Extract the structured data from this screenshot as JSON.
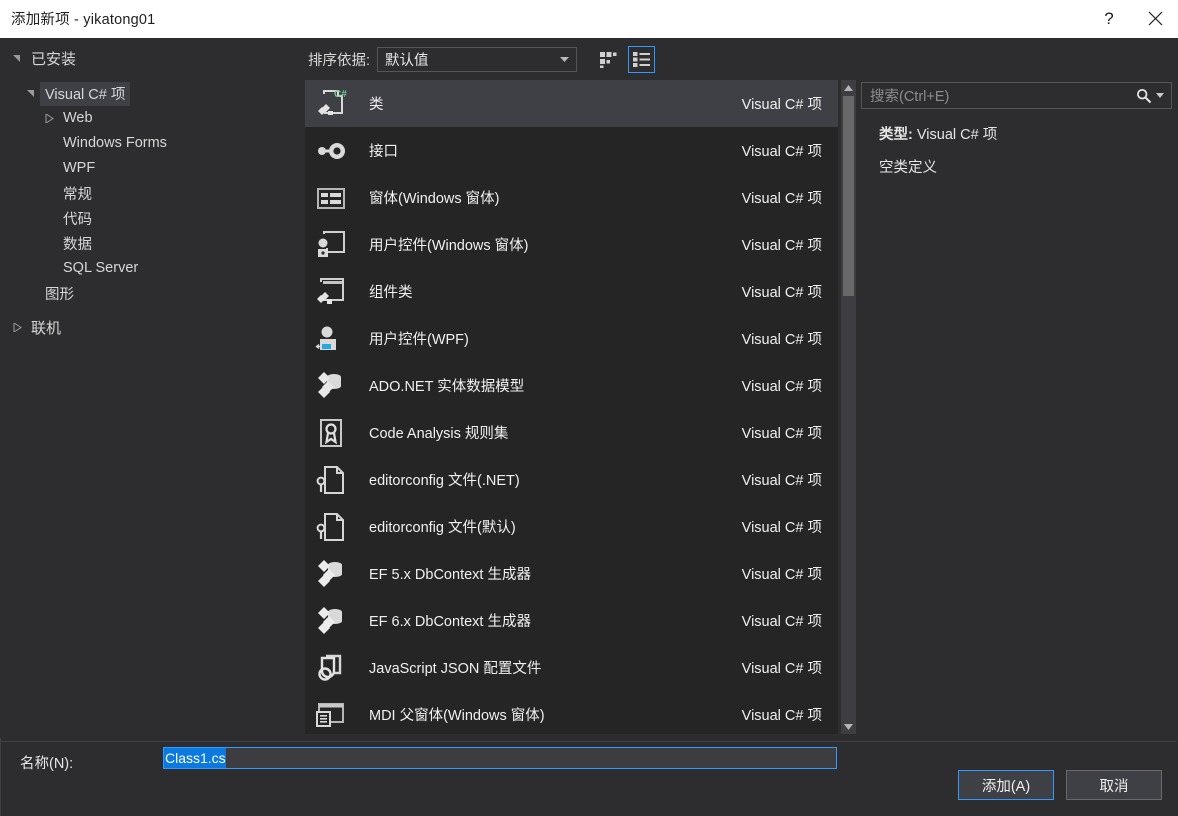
{
  "window": {
    "title": "添加新项 - yikatong01",
    "help_icon": "question-mark-icon",
    "close_icon": "close-icon"
  },
  "sidebar": {
    "installed": {
      "label": "已安装",
      "expanded": true
    },
    "items": [
      {
        "label": "Visual C# 项",
        "level": 1,
        "state": "expanded",
        "selected": true
      },
      {
        "label": "Web",
        "level": 2,
        "state": "collapsed",
        "selected": false
      },
      {
        "label": "Windows Forms",
        "level": 2,
        "state": "leaf",
        "selected": false
      },
      {
        "label": "WPF",
        "level": 2,
        "state": "leaf",
        "selected": false
      },
      {
        "label": "常规",
        "level": 2,
        "state": "leaf",
        "selected": false
      },
      {
        "label": "代码",
        "level": 2,
        "state": "leaf",
        "selected": false
      },
      {
        "label": "数据",
        "level": 2,
        "state": "leaf",
        "selected": false
      },
      {
        "label": "SQL Server",
        "level": 2,
        "state": "leaf",
        "selected": false
      },
      {
        "label": "图形",
        "level": 1,
        "state": "leaf",
        "selected": false
      },
      {
        "label": "联机",
        "level": 0,
        "state": "collapsed",
        "selected": false
      }
    ]
  },
  "toolbar": {
    "sort_label": "排序依据:",
    "sort_value": "默认值",
    "sort_chevron_icon": "chevron-down-icon",
    "grid_view_icon": "grid-view-icon",
    "list_view_icon": "list-view-icon",
    "active_view": "list"
  },
  "templates": {
    "kind_label": "Visual C# 项",
    "rows": [
      {
        "name": "类",
        "kind": "Visual C# 项",
        "icon": "class-icon",
        "selected": true
      },
      {
        "name": "接口",
        "kind": "Visual C# 项",
        "icon": "interface-icon",
        "selected": false
      },
      {
        "name": "窗体(Windows 窗体)",
        "kind": "Visual C# 项",
        "icon": "winform-icon",
        "selected": false
      },
      {
        "name": "用户控件(Windows 窗体)",
        "kind": "Visual C# 项",
        "icon": "usercontrol-winform-icon",
        "selected": false
      },
      {
        "name": "组件类",
        "kind": "Visual C# 项",
        "icon": "component-class-icon",
        "selected": false
      },
      {
        "name": "用户控件(WPF)",
        "kind": "Visual C# 项",
        "icon": "usercontrol-wpf-icon",
        "selected": false
      },
      {
        "name": "ADO.NET 实体数据模型",
        "kind": "Visual C# 项",
        "icon": "ado-net-model-icon",
        "selected": false
      },
      {
        "name": "Code Analysis 规则集",
        "kind": "Visual C# 项",
        "icon": "ruleset-icon",
        "selected": false
      },
      {
        "name": "editorconfig 文件(.NET)",
        "kind": "Visual C# 项",
        "icon": "editorconfig-icon",
        "selected": false
      },
      {
        "name": "editorconfig 文件(默认)",
        "kind": "Visual C# 项",
        "icon": "editorconfig-icon",
        "selected": false
      },
      {
        "name": "EF 5.x DbContext 生成器",
        "kind": "Visual C# 项",
        "icon": "ef-dbcontext-icon",
        "selected": false
      },
      {
        "name": "EF 6.x DbContext 生成器",
        "kind": "Visual C# 项",
        "icon": "ef-dbcontext-icon",
        "selected": false
      },
      {
        "name": "JavaScript JSON 配置文件",
        "kind": "Visual C# 项",
        "icon": "json-file-icon",
        "selected": false
      },
      {
        "name": "MDI 父窗体(Windows 窗体)",
        "kind": "Visual C# 项",
        "icon": "mdi-parent-form-icon",
        "selected": false
      }
    ],
    "scrollbar": {
      "up_arrow_icon": "scroll-up-icon",
      "down_arrow_icon": "scroll-down-icon"
    }
  },
  "search": {
    "placeholder": "搜索(Ctrl+E)",
    "value": "",
    "search_icon": "search-icon",
    "dropdown_icon": "chevron-down-icon"
  },
  "details": {
    "type_label": "类型:",
    "type_value": "Visual C# 项",
    "description": "空类定义"
  },
  "footer": {
    "name_label": "名称(N):",
    "name_value": "Class1.cs",
    "add_button": "添加(A)",
    "cancel_button": "取消"
  },
  "colors": {
    "dialog_bg": "#2d2d30",
    "list_bg": "#252526",
    "selection_bg": "#3f3f46",
    "accent_blue": "#3399ff",
    "text_selection_blue": "#0a7ae0",
    "titlebar_bg": "#ffffff"
  }
}
